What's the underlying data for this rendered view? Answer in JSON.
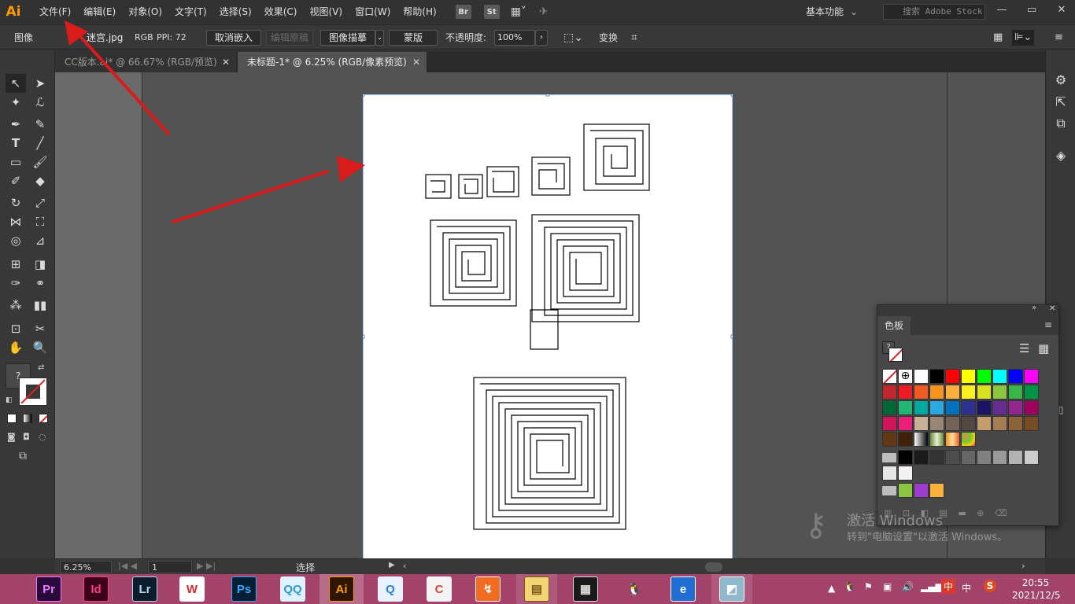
{
  "app": {
    "logo": "Ai"
  },
  "menu": [
    "文件(F)",
    "编辑(E)",
    "对象(O)",
    "文字(T)",
    "选择(S)",
    "效果(C)",
    "视图(V)",
    "窗口(W)",
    "帮助(H)"
  ],
  "menu_buttons": {
    "bridge": "Br",
    "stock": "St"
  },
  "workspace": {
    "label": "基本功能",
    "search_placeholder": "搜索 Adobe Stock"
  },
  "control_bar": {
    "object_type": "图像",
    "file_name": "迷宫.jpg",
    "color_mode": "RGB",
    "ppi": "PPI: 72",
    "unembed": "取消嵌入",
    "edit_original": "编辑原稿",
    "image_trace": "图像描摹",
    "mask": "蒙版",
    "opacity_label": "不透明度:",
    "opacity_value": "100%",
    "transform": "变换"
  },
  "tabs": [
    {
      "label": "CC版本.ai* @ 66.67% (RGB/预览)",
      "active": false
    },
    {
      "label": "未标题-1* @ 6.25% (RGB/像素预览)",
      "active": true
    }
  ],
  "status_bar": {
    "zoom": "6.25%",
    "page": "1",
    "mode": "选择"
  },
  "swatch_panel": {
    "title": "色板",
    "rows": [
      [
        "none",
        "registration",
        "#ffffff",
        "#000000",
        "#ff0000",
        "#ffff00",
        "#00ff00",
        "#00ffff",
        "#0000ff",
        "#ff00ff"
      ],
      [
        "#c1272d",
        "#ed1c24",
        "#f15a24",
        "#f7931e",
        "#fbb03b",
        "#fcee21",
        "#d9e021",
        "#8cc63f",
        "#39b54a",
        "#009245"
      ],
      [
        "#006837",
        "#22b573",
        "#00a99d",
        "#29abe2",
        "#0071bc",
        "#2e3192",
        "#1b1464",
        "#662d91",
        "#93278f",
        "#9e005d"
      ],
      [
        "#d4145a",
        "#ed1e79",
        "#c7b299",
        "#998675",
        "#736357",
        "#534741",
        "#c69c6d",
        "#a67c52",
        "#8c6239",
        "#754c24"
      ],
      [
        "#603813",
        "#42210b",
        "gradient-bw",
        "gradient-green",
        "gradient-orange",
        "pattern-dots"
      ],
      [
        "folder",
        "#000000",
        "#1a1a1a",
        "#333333",
        "#4d4d4d",
        "#666666",
        "#808080",
        "#999999",
        "#b3b3b3",
        "#cccccc"
      ],
      [
        "#e6e6e6",
        "#f2f2f2"
      ],
      [
        "folder",
        "#8cc63f",
        "#9e3ccf",
        "#fbb03b"
      ]
    ]
  },
  "watermark": {
    "title": "激活 Windows",
    "subtitle": "转到\"电脑设置\"以激活 Windows。"
  },
  "taskbar": {
    "apps": [
      {
        "name": "Pr",
        "bg": "#2a0a3a",
        "fg": "#e77cff"
      },
      {
        "name": "Id",
        "bg": "#3a0218",
        "fg": "#ff3d7f"
      },
      {
        "name": "Lr",
        "bg": "#0b1d2b",
        "fg": "#b4d7f0"
      },
      {
        "name": "W",
        "bg": "#ffffff",
        "fg": "#d42b2b"
      },
      {
        "name": "Ps",
        "bg": "#061e33",
        "fg": "#31a8ff"
      },
      {
        "name": "QQ",
        "bg": "#dff1fb",
        "fg": "#2b9bd8"
      },
      {
        "name": "Ai",
        "bg": "#2d1700",
        "fg": "#ff9a00"
      },
      {
        "name": "Q",
        "bg": "#e8f3ff",
        "fg": "#2a7de1"
      },
      {
        "name": "C",
        "bg": "#f3f3f3",
        "fg": "#db4437"
      },
      {
        "name": "↯",
        "bg": "#f26b21",
        "fg": "#ffffff"
      },
      {
        "name": "▤",
        "bg": "#f2d675",
        "fg": "#7a5a12"
      },
      {
        "name": "▦",
        "bg": "#1a1a1a",
        "fg": "#dddddd"
      },
      {
        "name": "🐧",
        "bg": "transparent",
        "fg": "#000000"
      },
      {
        "name": "e",
        "bg": "#1f6ed4",
        "fg": "#ffffff"
      },
      {
        "name": "◩",
        "bg": "#8fb8cc",
        "fg": "#ffffff"
      }
    ],
    "clock_time": "20:55",
    "clock_date": "2021/12/5",
    "ime": "中"
  }
}
